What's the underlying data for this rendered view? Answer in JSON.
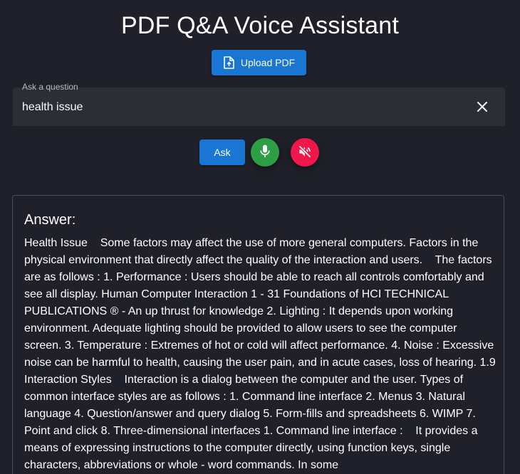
{
  "app": {
    "title": "PDF Q&A Voice Assistant"
  },
  "upload": {
    "label": "Upload PDF",
    "icon": "file-upload-icon"
  },
  "question": {
    "label": "Ask a question",
    "value": "health issue",
    "clear_icon": "close-icon"
  },
  "controls": {
    "ask_label": "Ask",
    "mic_icon": "microphone-icon",
    "mute_icon": "volume-off-icon"
  },
  "answer": {
    "heading": "Answer:",
    "text": "Health Issue    Some factors may affect the use of more general computers. Factors in the physical environment that directly affect the quality of the interaction and users.    The factors are as follows : 1. Performance : Users should be able to reach all controls comfortably and see all display. Human Computer Interaction 1 - 31 Foundations of HCI TECHNICAL PUBLICATIONS ® - An up thrust for knowledge 2. Lighting : It depends upon working environment. Adequate lighting should be provided to allow users to see the computer screen. 3. Temperature : Extremes of hot or cold will affect performance. 4. Noise : Excessive noise can be harmful to health, causing the user pain, and in acute cases, loss of hearing. 1.9 Interaction Styles    Interaction is a dialog between the computer and the user. Types of common interface styles are as follows : 1. Command line interface 2. Menus 3. Natural language 4. Question/answer and query dialog 5. Form-fills and spreadsheets 6. WIMP 7. Point and click 8. Three-dimensional interfaces 1. Command line interface :    It provides a means of expressing instructions to the computer directly, using function keys, single characters, abbreviations or whole - word commands. In some"
  },
  "colors": {
    "background": "#1f2029",
    "primary": "#1976d2",
    "mic": "#2e9e44",
    "mute": "#f0184a",
    "field": "#2c2e36"
  }
}
